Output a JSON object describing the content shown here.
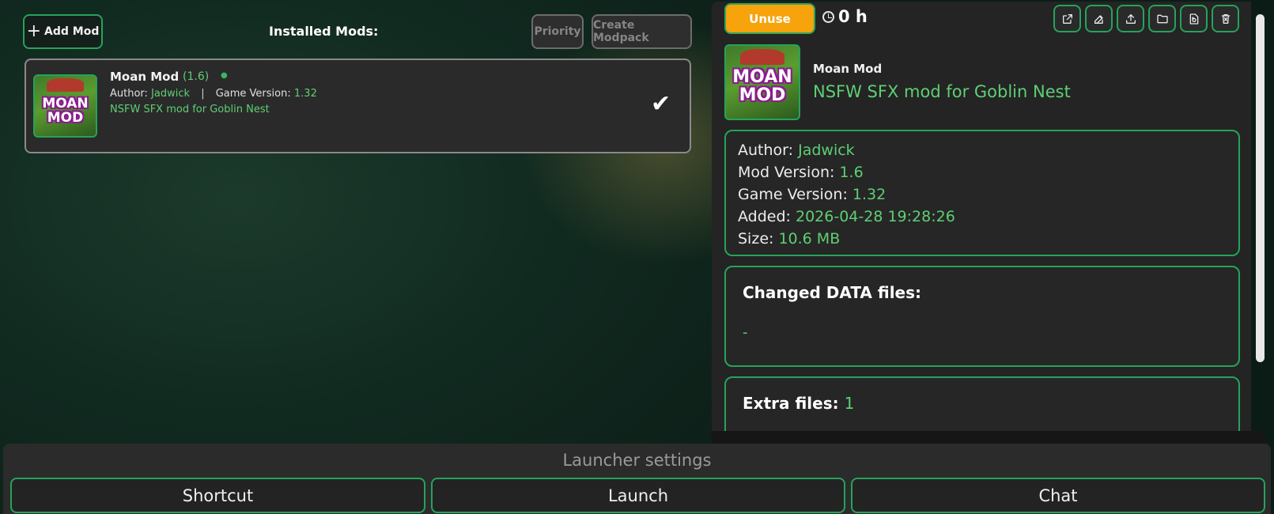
{
  "toolbar": {
    "add_mod_label": "Add Mod",
    "add_icon": "plus-icon",
    "installed_title": "Installed Mods:",
    "priority_label": "Priority",
    "create_modpack_label": "Create Modpack"
  },
  "mods": [
    {
      "name": "Moan Mod",
      "version": "(1.6)",
      "author_label": "Author:",
      "author": "Jadwick",
      "game_version_label": "Game Version:",
      "game_version": "1.32",
      "description": "NSFW SFX mod for Goblin Nest",
      "thumbnail_line1": "MOAN",
      "thumbnail_line2": "MOD",
      "status_icon": "checkmark-icon"
    }
  ],
  "details": {
    "unuse_label": "Unuse",
    "playtime": "0 h",
    "action_icons": [
      "external-link-icon",
      "edit-icon",
      "upload-icon",
      "folder-icon",
      "refresh-file-icon",
      "trash-icon"
    ],
    "name": "Moan Mod",
    "description": "NSFW SFX mod for Goblin Nest",
    "thumbnail_line1": "MOAN",
    "thumbnail_line2": "MOD",
    "info": {
      "author_label": "Author:",
      "author": "Jadwick",
      "mod_version_label": "Mod Version:",
      "mod_version": "1.6",
      "game_version_label": "Game Version:",
      "game_version": "1.32",
      "added_label": "Added:",
      "added": "2026-04-28 19:28:26",
      "size_label": "Size:",
      "size": "10.6 MB"
    },
    "changed_data_title": "Changed DATA files:",
    "changed_data_value": "-",
    "extra_files_title": "Extra files:",
    "extra_files_count": "1"
  },
  "bottom": {
    "launcher_settings": "Launcher settings",
    "shortcut_label": "Shortcut",
    "launch_label": "Launch",
    "chat_label": "Chat"
  },
  "colors": {
    "accent_green": "#25a35a",
    "value_green": "#5ecf74",
    "unuse_orange": "#f7a30c"
  }
}
